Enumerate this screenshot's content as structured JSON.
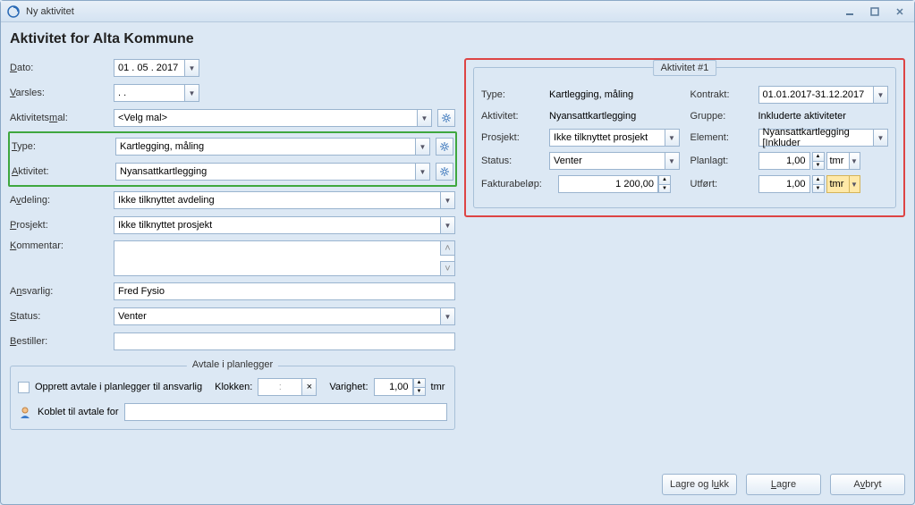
{
  "window": {
    "title": "Ny aktivitet"
  },
  "heading": "Aktivitet for Alta Kommune",
  "left": {
    "dato_label_pre": "D",
    "dato_label_post": "ato:",
    "dato_value": "01 . 05 . 2017",
    "varsles_label_pre": "V",
    "varsles_label_post": "arsles:",
    "varsles_value": ". .",
    "aktivitetsmal_label_pre1": "Aktivitets",
    "aktivitetsmal_label_ul": "m",
    "aktivitetsmal_label_post": "al:",
    "aktivitetsmal_value": "<Velg mal>",
    "type_label_pre": "T",
    "type_label_post": "ype:",
    "type_value": "Kartlegging, måling",
    "aktivitet_label_pre": "A",
    "aktivitet_label_post": "ktivitet:",
    "aktivitet_value": "Nyansattkartlegging",
    "avdeling_label_pre1": "A",
    "avdeling_label_ul": "v",
    "avdeling_label_post": "deling:",
    "avdeling_value": "Ikke tilknyttet avdeling",
    "prosjekt_label_pre": "P",
    "prosjekt_label_post": "rosjekt:",
    "prosjekt_value": "Ikke tilknyttet prosjekt",
    "kommentar_label_pre": "K",
    "kommentar_label_post": "ommentar:",
    "ansvarlig_label_pre1": "A",
    "ansvarlig_label_ul": "n",
    "ansvarlig_label_post": "svarlig:",
    "ansvarlig_value": "Fred Fysio",
    "status_label_pre": "S",
    "status_label_post": "tatus:",
    "status_value": "Venter",
    "bestiller_label_pre": "B",
    "bestiller_label_post": "estiller:",
    "bestiller_value": ""
  },
  "avtale": {
    "legend": "Avtale i planlegger",
    "checkbox_label": "Opprett avtale i planlegger til ansvarlig",
    "klokken_label": "Klokken:",
    "klokken_value": ":",
    "varighet_label": "Varighet:",
    "varighet_value": "1,00",
    "varighet_unit": "tmr",
    "koblet_label": "Koblet til avtale for",
    "koblet_value": ""
  },
  "right": {
    "legend": "Aktivitet #1",
    "type_label": "Type:",
    "type_value": "Kartlegging, måling",
    "kontrakt_label": "Kontrakt:",
    "kontrakt_value": "01.01.2017-31.12.2017",
    "aktivitet_label": "Aktivitet:",
    "aktivitet_value": "Nyansattkartlegging",
    "gruppe_label": "Gruppe:",
    "gruppe_value": "Inkluderte aktiviteter",
    "prosjekt_label": "Prosjekt:",
    "prosjekt_value": "Ikke tilknyttet prosjekt",
    "element_label": "Element:",
    "element_value": "Nyansattkartlegging  [Inkluder",
    "status_label": "Status:",
    "status_value": "Venter",
    "planlagt_label": "Planlagt:",
    "planlagt_value": "1,00",
    "planlagt_unit": "tmr",
    "faktura_label": "Fakturabeløp:",
    "faktura_value": "1 200,00",
    "utfort_label": "Utført:",
    "utfort_value": "1,00",
    "utfort_unit": "tmr"
  },
  "footer": {
    "save_close_pre": "Lagre og l",
    "save_close_ul": "u",
    "save_close_post": "kk",
    "save_pre": "",
    "save_ul": "L",
    "save_post": "agre",
    "cancel_pre": "A",
    "cancel_ul": "v",
    "cancel_post": "bryt"
  }
}
